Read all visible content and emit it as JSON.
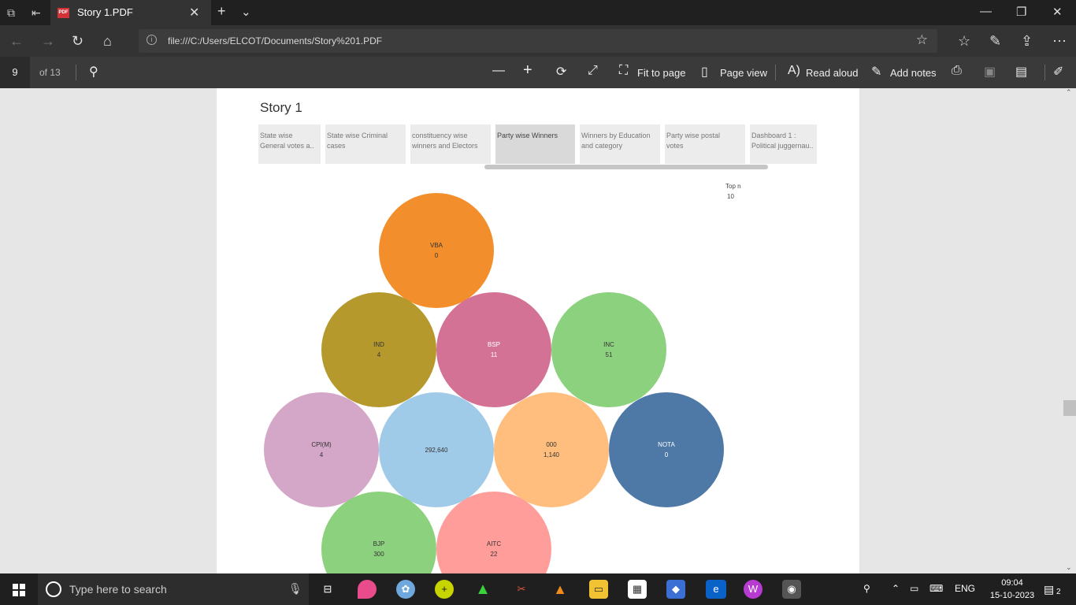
{
  "browser": {
    "tab_title": "Story 1.PDF",
    "pdf_badge": "PDF",
    "address": "file:///C:/Users/ELCOT/Documents/Story%201.PDF"
  },
  "pdf_toolbar": {
    "page_number": "9",
    "page_total": "of 13",
    "fit_to_page": "Fit to page",
    "page_view": "Page view",
    "read_aloud": "Read aloud",
    "add_notes": "Add notes"
  },
  "story": {
    "title": "Story 1",
    "tabs": [
      {
        "line1": "State wise",
        "line2": "General votes a.."
      },
      {
        "line1": "State wise Criminal",
        "line2": "cases"
      },
      {
        "line1": "constituency wise",
        "line2": "winners and Electors"
      },
      {
        "line1": "Party wise Winners",
        "line2": ""
      },
      {
        "line1": "Winners by Education",
        "line2": "and category"
      },
      {
        "line1": "Party wise postal",
        "line2": "votes"
      },
      {
        "line1": "Dashboard 1 :",
        "line2": "Political juggernau.."
      }
    ],
    "active_tab": 3,
    "top_n_label": "Top n",
    "top_n_value": "10"
  },
  "chart_data": {
    "type": "packed-bubble",
    "bubbles": [
      {
        "party": "VBA",
        "value": "0",
        "color": "#f28e2b"
      },
      {
        "party": "IND",
        "value": "4",
        "color": "#b6992d"
      },
      {
        "party": "BSP",
        "value": "11",
        "color": "#d37295"
      },
      {
        "party": "INC",
        "value": "51",
        "color": "#8cd17d"
      },
      {
        "party": "CPI(M)",
        "value": "4",
        "color": "#d4a6c8"
      },
      {
        "party": "",
        "value": "292,640",
        "color": "#a0cbe8"
      },
      {
        "party": "000",
        "value": "1,140",
        "color": "#ffbe7d"
      },
      {
        "party": "NOTA",
        "value": "0",
        "color": "#4e79a7"
      },
      {
        "party": "BJP",
        "value": "300",
        "color": "#8cd17d"
      },
      {
        "party": "AITC",
        "value": "22",
        "color": "#ff9d9a"
      }
    ]
  },
  "taskbar": {
    "search_placeholder": "Type here to search",
    "lang": "ENG",
    "time": "09:04",
    "date": "15-10-2023",
    "notification_count": "2"
  }
}
